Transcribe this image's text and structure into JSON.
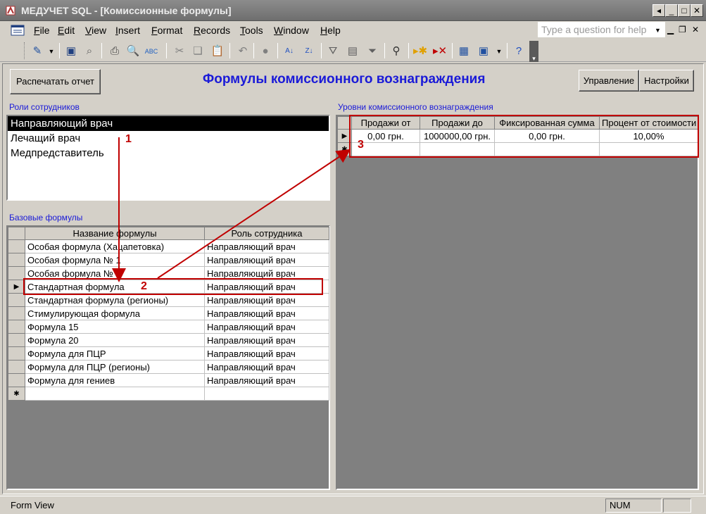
{
  "window": {
    "title": "МЕДУЧЕТ SQL - [Комиссионные формулы]"
  },
  "menu": {
    "items": [
      "File",
      "Edit",
      "View",
      "Insert",
      "Format",
      "Records",
      "Tools",
      "Window",
      "Help"
    ],
    "help_placeholder": "Type a question for help"
  },
  "toolbar": {
    "icons": [
      "design-view-icon",
      "save-icon",
      "search-file-icon",
      "print-icon",
      "print-preview-icon",
      "spelling-icon",
      "cut-icon",
      "copy-icon",
      "paste-icon",
      "undo-icon",
      "hyperlink-icon",
      "sort-ascending-icon",
      "sort-descending-icon",
      "filter-by-selection-icon",
      "filter-by-form-icon",
      "apply-filter-icon",
      "find-icon",
      "new-record-icon",
      "delete-record-icon",
      "database-window-icon",
      "new-object-icon",
      "help-icon"
    ]
  },
  "form": {
    "print_button": "Распечатать отчет",
    "title": "Формулы комиссионного вознаграждения",
    "manage_button": "Управление",
    "settings_button": "Настройки",
    "roles_label": "Роли сотрудников",
    "roles": [
      {
        "name": "Направляющий врач",
        "selected": true
      },
      {
        "name": "Лечащий врач",
        "selected": false
      },
      {
        "name": "Медпредставитель",
        "selected": false
      }
    ],
    "formulas_label": "Базовые формулы",
    "formulas_columns": [
      "Название формулы",
      "Роль сотрудника"
    ],
    "formulas": [
      [
        "Особая формула (Хацапетовка)",
        "Направляющий врач"
      ],
      [
        "Особая формула № 1",
        "Направляющий врач"
      ],
      [
        "Особая формула № 2",
        "Направляющий врач"
      ],
      [
        "Стандартная формула",
        "Направляющий врач"
      ],
      [
        "Стандартная формула (регионы)",
        "Направляющий врач"
      ],
      [
        "Стимулирующая формула",
        "Направляющий врач"
      ],
      [
        "Формула 15",
        "Направляющий врач"
      ],
      [
        "Формула 20",
        "Направляющий врач"
      ],
      [
        "Формула для ПЦР",
        "Направляющий врач"
      ],
      [
        "Формула для ПЦР (регионы)",
        "Направляющий врач"
      ],
      [
        "Формула для гениев",
        "Направляющий врач"
      ]
    ],
    "formulas_current_row": 3,
    "levels_label": "Уровни комиссионного вознаграждения",
    "levels_columns": [
      "Продажи от",
      "Продажи до",
      "Фиксированная сумма",
      "Процент от стоимости"
    ],
    "levels": [
      [
        "0,00 грн.",
        "1000000,00 грн.",
        "0,00 грн.",
        "10,00%"
      ]
    ]
  },
  "annotations": [
    "1",
    "2",
    "3"
  ],
  "status": {
    "left": "Form View",
    "num": "NUM"
  },
  "colors": {
    "annotation": "#c00000",
    "title_blue": "#1a1ad8",
    "titlebar": "#7a7a7a"
  }
}
